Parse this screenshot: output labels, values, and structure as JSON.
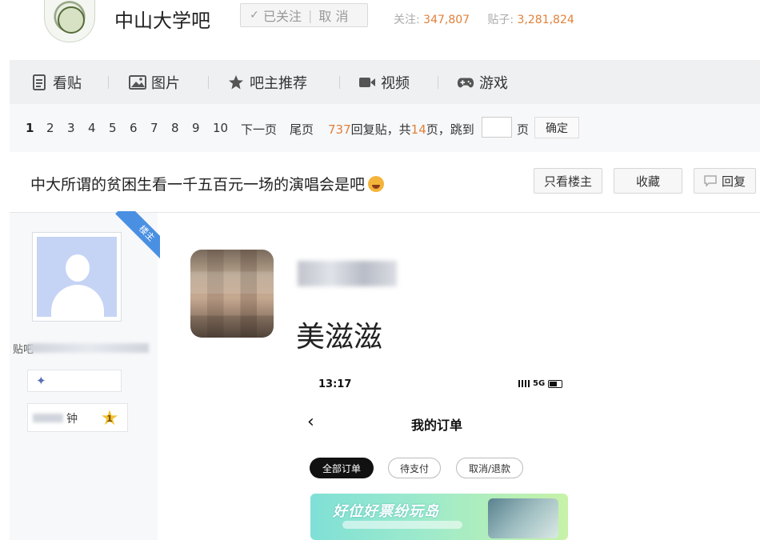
{
  "header": {
    "forum_title": "中山大学吧",
    "follow_state": "已关注",
    "unfollow": "取 消",
    "followers_label": "关注:",
    "followers_value": "347,807",
    "posts_label": "贴子:",
    "posts_value": "3,281,824"
  },
  "nav": {
    "items": [
      {
        "label": "看贴",
        "icon": "document-icon"
      },
      {
        "label": "图片",
        "icon": "image-icon"
      },
      {
        "label": "吧主推荐",
        "icon": "star-icon"
      },
      {
        "label": "视频",
        "icon": "video-icon"
      },
      {
        "label": "游戏",
        "icon": "gamepad-icon"
      }
    ]
  },
  "pager": {
    "pages": [
      "1",
      "2",
      "3",
      "4",
      "5",
      "6",
      "7",
      "8",
      "9",
      "10"
    ],
    "current": "1",
    "next": "下一页",
    "last": "尾页",
    "reply_count": "737",
    "reply_label": "回复贴，共",
    "page_total": "14",
    "page_unit": "页，跳到",
    "page_suffix": "页",
    "confirm": "确定"
  },
  "thread": {
    "title": "中大所谓的贫困生看一千五百元一场的演唱会是吧",
    "only_op": "只看楼主",
    "favorite": "收藏",
    "reply": "回复"
  },
  "user": {
    "op_badge": "楼主",
    "name_prefix": "贴吧",
    "level_suffix": "钟",
    "star_level": "1"
  },
  "post": {
    "text": "美滋滋"
  },
  "phone": {
    "time": "13:17",
    "network": "5G",
    "title": "我的订单",
    "chips": [
      "全部订单",
      "待支付",
      "取消/退款"
    ],
    "banner_text": "好位好票纷玩岛"
  }
}
